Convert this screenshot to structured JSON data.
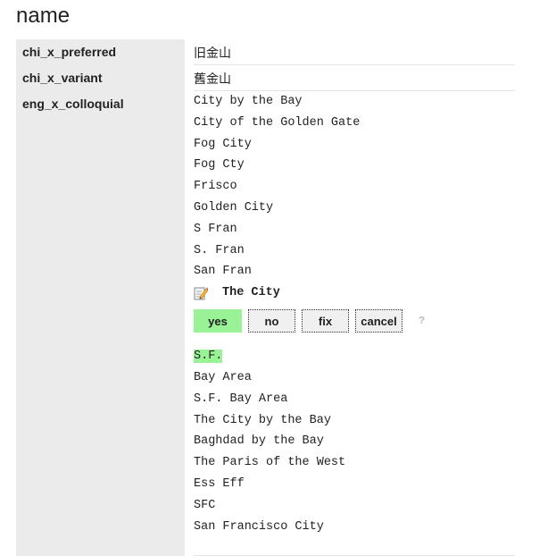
{
  "section_title": "name",
  "rows": [
    {
      "key": "chi_x_preferred",
      "values": [
        "旧金山"
      ]
    },
    {
      "key": "chi_x_variant",
      "values": [
        "舊金山"
      ]
    },
    {
      "key": "eng_x_colloquial",
      "values_before": [
        "City by the Bay",
        "City of the Golden Gate",
        "Fog City",
        "Fog Cty",
        "Frisco",
        "Golden City",
        "S Fran",
        "S. Fran",
        "San Fran"
      ],
      "editing": {
        "icon": "pencil-edit-icon",
        "value": "The City",
        "buttons": {
          "yes": "yes",
          "no": "no",
          "fix": "fix",
          "cancel": "cancel",
          "help": "?"
        }
      },
      "highlighted": "S.F.",
      "values_after": [
        "Bay Area",
        "S.F. Bay Area",
        "The City by the Bay",
        "Baghdad by the Bay",
        "The Paris of the West",
        "Ess Eff",
        "SFC",
        "San Francisco City"
      ]
    }
  ],
  "colors": {
    "key_bg": "#ebebeb",
    "accept_green": "#99f296",
    "divider": "#e4e4e4"
  }
}
